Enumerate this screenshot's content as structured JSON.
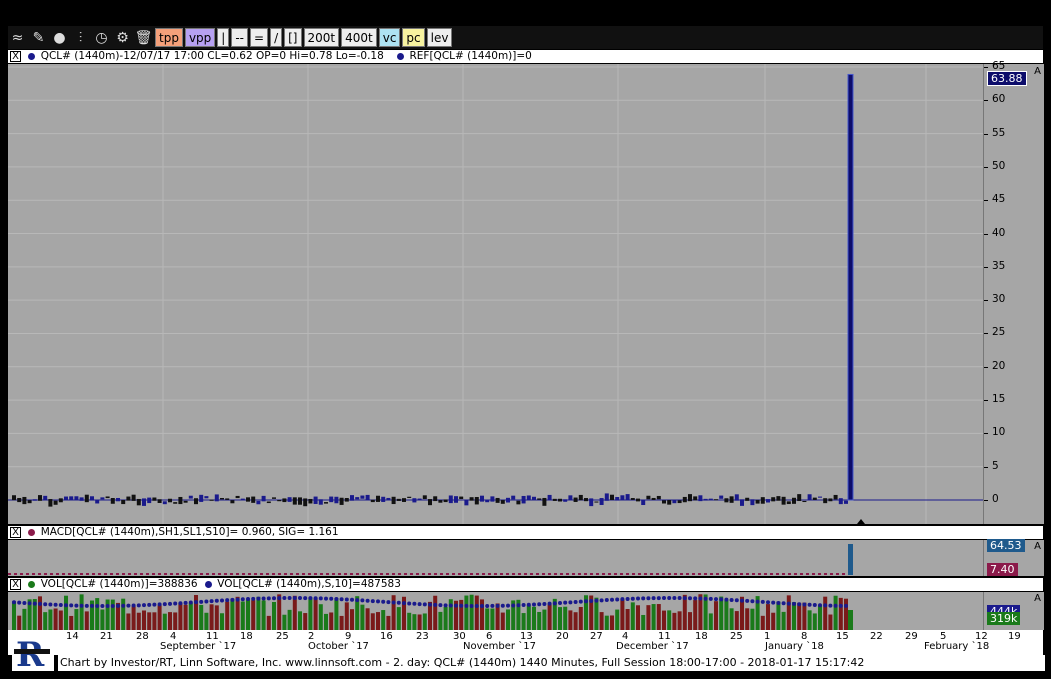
{
  "toolbar": {
    "icons": [
      "chart-type-icon",
      "draw-pencil-icon",
      "bomb-icon",
      "candles-icon",
      "clock-icon",
      "gear-icon",
      "trash-icon"
    ],
    "buttons": [
      "tpp",
      "vpp",
      "|",
      "--",
      "=",
      "/",
      "[]",
      "200t",
      "400t",
      "vc",
      "pc",
      "lev"
    ]
  },
  "price_panel": {
    "header_close": "X",
    "header_text": "QCL# (1440m)-12/07/17 17:00 CL=0.62 OP=0 Hi=0.78 Lo=-0.18",
    "ref_text": "REF[QCL# (1440m)]=0",
    "y_ticks": [
      "65",
      "60",
      "55",
      "50",
      "45",
      "40",
      "35",
      "30",
      "25",
      "20",
      "15",
      "10",
      "5",
      "0"
    ],
    "last_price_tag": "63.88",
    "axis_mode": "A",
    "colors": {
      "up": "#1a1a8c",
      "down": "#111111",
      "spike": "#0d0d6b"
    }
  },
  "macd_panel": {
    "header_close": "X",
    "header_text": "MACD[QCL# (1440m),SH1,SL1,S10]=  0.960, SIG=  1.161",
    "tag_macd": "64.53",
    "tag_sig": "7.40",
    "axis_mode": "A"
  },
  "vol_panel": {
    "header_close": "X",
    "header_text": "VOL[QCL# (1440m)]=388836",
    "header_text2": "VOL[QCL# (1440m),S,10]=487583",
    "tag_ma": "444k",
    "tag_vol": "319k",
    "axis_mode": "A"
  },
  "x_axis": {
    "day_labels": [
      "14",
      "21",
      "28",
      "4",
      "11",
      "18",
      "25",
      "2",
      "9",
      "16",
      "23",
      "30",
      "6",
      "13",
      "20",
      "27",
      "4",
      "11",
      "18",
      "25",
      "1",
      "8",
      "15",
      "22",
      "29",
      "5",
      "12",
      "19"
    ],
    "month_labels": [
      "September `17",
      "October `17",
      "November `17",
      "December `17",
      "January `18",
      "February `18"
    ]
  },
  "footer": {
    "text": "Chart by Investor/RT, Linn Software, Inc. www.linnsoft.com - 2. day: QCL# (1440m) 1440 Minutes, Full Session 18:00-17:00 - 2018-01-17 15:17:42"
  },
  "chart_data": {
    "type": "bar",
    "title": "",
    "series": [
      {
        "name": "QCL# (1440m)",
        "values": [
          0.62
        ]
      }
    ],
    "spike_value": 63.88,
    "ylim": [
      -4,
      66
    ],
    "grid": true
  }
}
